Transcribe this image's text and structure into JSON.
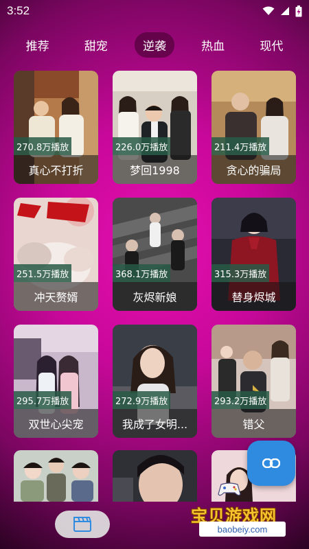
{
  "status": {
    "time": "3:52"
  },
  "tabs": [
    {
      "label": "推荐",
      "active": false
    },
    {
      "label": "甜宠",
      "active": false
    },
    {
      "label": "逆袭",
      "active": true
    },
    {
      "label": "热血",
      "active": false
    },
    {
      "label": "现代",
      "active": false
    }
  ],
  "cards": [
    {
      "plays": "270.8万播放",
      "title": "真心不打折"
    },
    {
      "plays": "226.0万播放",
      "title": "梦回1998"
    },
    {
      "plays": "211.4万播放",
      "title": "贪心的骗局"
    },
    {
      "plays": "251.5万播放",
      "title": "冲天赘婿"
    },
    {
      "plays": "368.1万播放",
      "title": "灰烬新娘"
    },
    {
      "plays": "315.3万播放",
      "title": "替身烬城"
    },
    {
      "plays": "295.7万播放",
      "title": "双世心尖宠"
    },
    {
      "plays": "272.9万播放",
      "title": "我成了女明..."
    },
    {
      "plays": "293.2万播放",
      "title": "错父"
    }
  ],
  "fab": {
    "icon": "link-icon"
  },
  "bottom_nav": {
    "icon": "clapperboard-icon"
  },
  "watermark": {
    "text": "宝贝游戏网",
    "url": "baobeiy.com"
  },
  "colors": {
    "accent": "#e60fb0",
    "fab": "#2f8be0",
    "plays_badge": "#285a46"
  }
}
